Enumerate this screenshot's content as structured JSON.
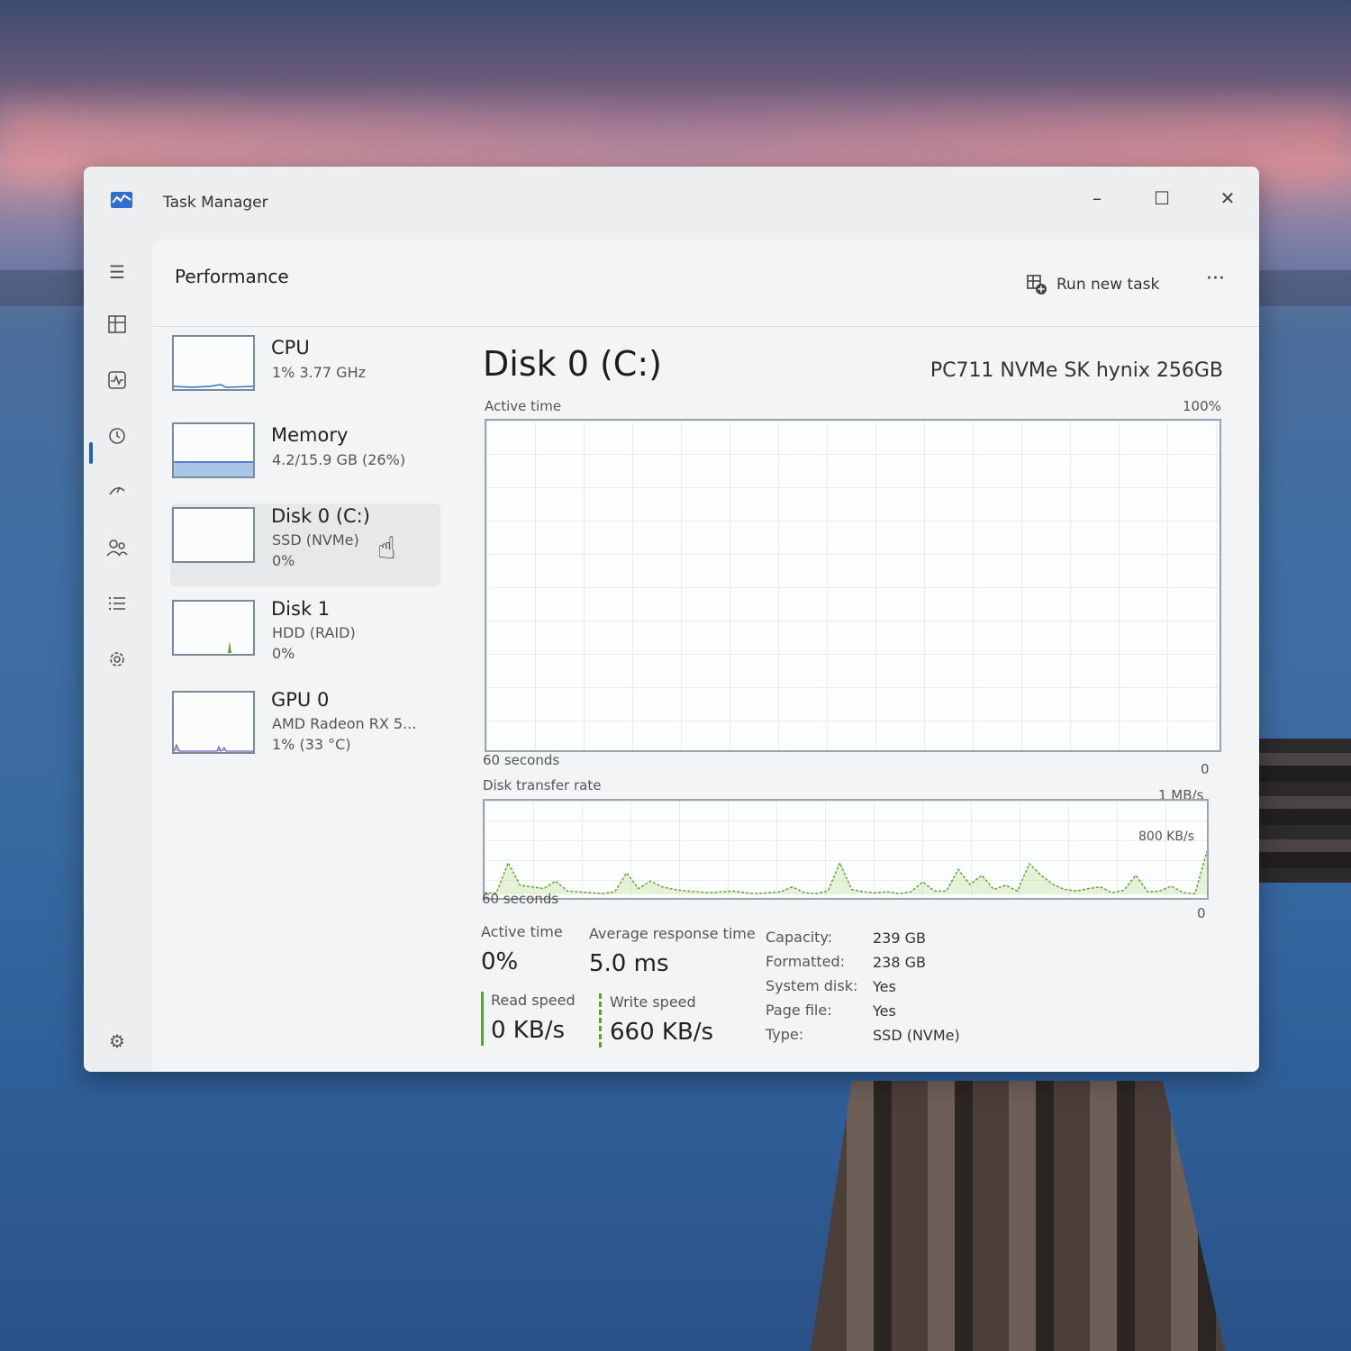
{
  "window": {
    "title": "Task Manager",
    "minimize": "–",
    "maximize": "☐",
    "close": "✕"
  },
  "header": {
    "page_title": "Performance",
    "run_new_task": "Run new task",
    "more": "···"
  },
  "devices": [
    {
      "name": "CPU",
      "line1": "1% 3.77 GHz",
      "line2": ""
    },
    {
      "name": "Memory",
      "line1": "4.2/15.9 GB (26%)",
      "line2": ""
    },
    {
      "name": "Disk 0 (C:)",
      "line1": "SSD (NVMe)",
      "line2": "0%"
    },
    {
      "name": "Disk 1",
      "line1": "HDD (RAID)",
      "line2": "0%"
    },
    {
      "name": "GPU 0",
      "line1": "AMD Radeon RX 5...",
      "line2": "1% (33 °C)"
    }
  ],
  "detail": {
    "title": "Disk 0 (C:)",
    "model": "PC711 NVMe SK hynix 256GB",
    "active_time_label": "Active time",
    "active_time_max": "100%",
    "active_time_span": "60 seconds",
    "active_time_min": "0",
    "transfer_label": "Disk transfer rate",
    "transfer_max": "1 MB/s",
    "transfer_mid": "800 KB/s",
    "transfer_span": "60 seconds",
    "transfer_min": "0"
  },
  "stats": {
    "active_time_label": "Active time",
    "active_time_value": "0%",
    "avg_response_label": "Average response time",
    "avg_response_value": "5.0 ms",
    "read_label": "Read speed",
    "read_value": "0 KB/s",
    "write_label": "Write speed",
    "write_value": "660 KB/s"
  },
  "properties": [
    {
      "key": "Capacity:",
      "value": "239 GB"
    },
    {
      "key": "Formatted:",
      "value": "238 GB"
    },
    {
      "key": "System disk:",
      "value": "Yes"
    },
    {
      "key": "Page file:",
      "value": "Yes"
    },
    {
      "key": "Type:",
      "value": "SSD (NVMe)"
    }
  ],
  "colors": {
    "accent": "#1f5fbf",
    "disk_line": "#5aa02c",
    "disk_fill": "#b7dd8f",
    "memory_fill": "#a9c6e8",
    "gpu_line": "#7a5fc0"
  },
  "chart_data": {
    "type": "line",
    "title": "Disk transfer rate",
    "ylabel": "",
    "ylim": [
      0,
      1000
    ],
    "series": [
      {
        "values": [
          20,
          15,
          380,
          110,
          90,
          70,
          160,
          40,
          30,
          20,
          10,
          30,
          260,
          70,
          160,
          90,
          60,
          40,
          30,
          20,
          30,
          40,
          20,
          10,
          20,
          30,
          90,
          20,
          10,
          40,
          380,
          60,
          30,
          20,
          30,
          10,
          30,
          150,
          40,
          40,
          300,
          120,
          230,
          60,
          110,
          40,
          370,
          230,
          120,
          60,
          40,
          70,
          90,
          20,
          50,
          230,
          30,
          40,
          100,
          20,
          10,
          520
        ]
      }
    ]
  }
}
